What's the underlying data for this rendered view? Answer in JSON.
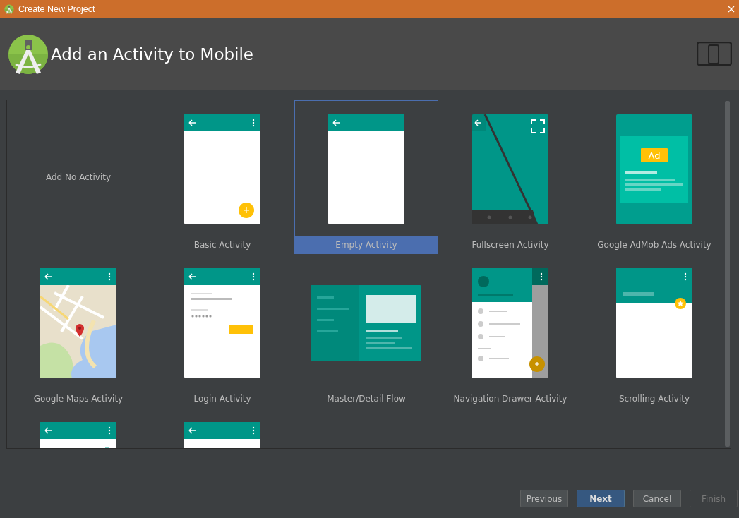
{
  "window": {
    "title": "Create New Project"
  },
  "header": {
    "title": "Add an Activity to Mobile"
  },
  "gallery": {
    "items": [
      {
        "kind": "none",
        "label": "Add No Activity",
        "selected": false
      },
      {
        "kind": "basic",
        "label": "Basic Activity",
        "selected": false
      },
      {
        "kind": "empty",
        "label": "Empty Activity",
        "selected": true
      },
      {
        "kind": "fullscreen",
        "label": "Fullscreen Activity",
        "selected": false
      },
      {
        "kind": "admob",
        "label": "Google AdMob Ads Activity",
        "selected": false,
        "badge": "Ad"
      },
      {
        "kind": "maps",
        "label": "Google Maps Activity",
        "selected": false
      },
      {
        "kind": "login",
        "label": "Login Activity",
        "selected": false
      },
      {
        "kind": "masterdetail",
        "label": "Master/Detail Flow",
        "selected": false
      },
      {
        "kind": "navdrawer",
        "label": "Navigation Drawer Activity",
        "selected": false
      },
      {
        "kind": "scrolling",
        "label": "Scrolling Activity",
        "selected": false
      },
      {
        "kind": "settings",
        "selected": false
      },
      {
        "kind": "tabbed",
        "selected": false
      }
    ]
  },
  "buttons": [
    {
      "label": "Previous",
      "kind": "default",
      "disabled": false
    },
    {
      "label": "Next",
      "kind": "primary",
      "disabled": false
    },
    {
      "label": "Cancel",
      "kind": "default",
      "disabled": false
    },
    {
      "label": "Finish",
      "kind": "default",
      "disabled": true
    }
  ]
}
